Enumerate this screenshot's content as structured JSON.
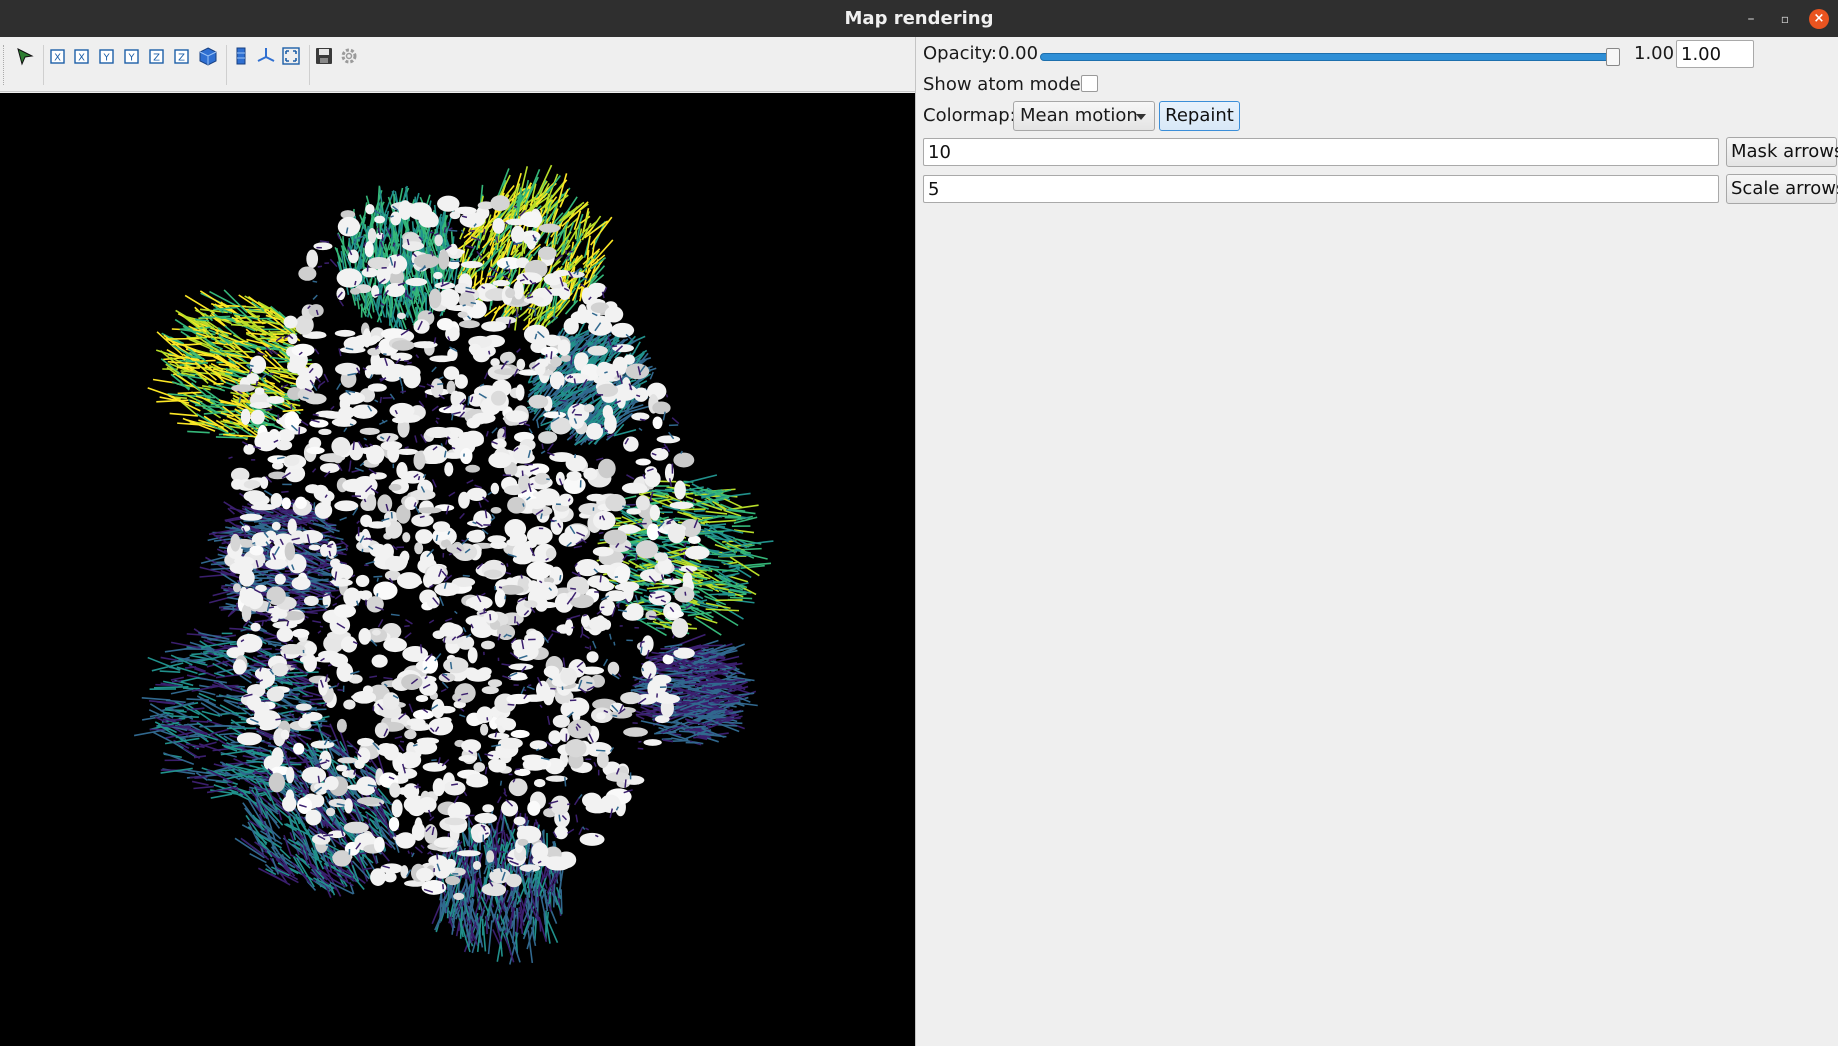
{
  "window": {
    "title": "Map rendering"
  },
  "toolbar": {
    "icons": [
      "pointer-arrow-icon",
      "view-x-plus-icon",
      "view-x-minus-icon",
      "view-y-plus-icon",
      "view-y-minus-icon",
      "view-z-plus-icon",
      "view-z-minus-icon",
      "view-isometric-icon",
      "parallel-projection-icon",
      "axes-triad-icon",
      "fit-all-icon",
      "save-icon",
      "settings-gear-icon"
    ],
    "axis_letters": [
      "X",
      "X",
      "Y",
      "Y",
      "Z",
      "Z"
    ]
  },
  "viewport": {
    "background": "#000000",
    "colormap_colors": [
      "#3b1f6e",
      "#31688e",
      "#21918c",
      "#35b779",
      "#b8de29",
      "#fde725"
    ],
    "surface_color": "#f2f2f2"
  },
  "panel": {
    "opacity": {
      "label": "Opacity:",
      "min_label": "0.00",
      "max_label": "1.00",
      "value": "1.00",
      "slider_fraction": 1.0
    },
    "atom_model": {
      "label": "Show atom model:",
      "checked": false
    },
    "colormap": {
      "label": "Colormap:",
      "selected": "Mean motion",
      "repaint_label": "Repaint"
    },
    "mask": {
      "value": "10",
      "button_label": "Mask arrows"
    },
    "scale": {
      "value": "5",
      "button_label": "Scale arrows"
    }
  }
}
